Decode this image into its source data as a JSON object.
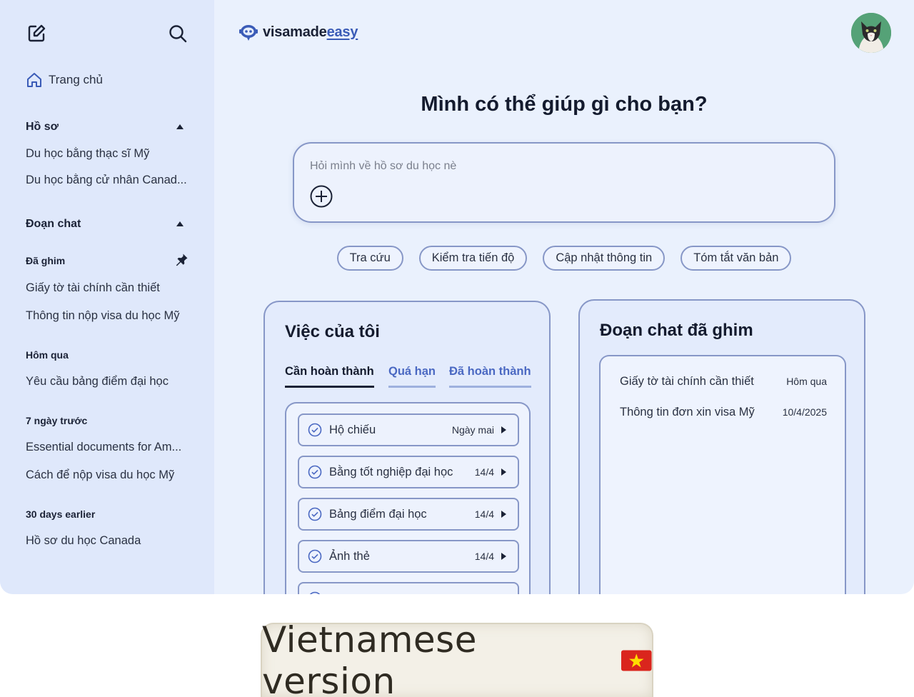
{
  "sidebar": {
    "new_chat_icon": "compose-icon",
    "search_icon": "search-icon",
    "home_label": "Trang chủ",
    "profiles": {
      "heading": "Hồ sơ",
      "items": [
        "Du học bằng thạc sĩ Mỹ",
        "Du học bằng cử nhân Canad..."
      ]
    },
    "chats": {
      "heading": "Đoạn chat",
      "groups": [
        {
          "title": "Đã ghim",
          "items": [
            "Giấy tờ tài chính cần thiết",
            "Thông tin nộp visa du học Mỹ"
          ]
        },
        {
          "title": "Hôm qua",
          "items": [
            "Yêu cầu bảng điểm đại học"
          ]
        },
        {
          "title": "7 ngày trước",
          "items": [
            "Essential documents for Am...",
            "Cách để nộp visa du học Mỹ"
          ]
        },
        {
          "title": "30 days earlier",
          "items": [
            "Hồ sơ du học Canada"
          ]
        }
      ]
    }
  },
  "header": {
    "logo_part1": "visamade",
    "logo_part2": "easy"
  },
  "main": {
    "headline": "Mình có thể giúp gì cho bạn?",
    "prompt_placeholder": "Hỏi mình về hồ sơ du học nè",
    "chips": [
      "Tra cứu",
      "Kiểm tra tiến độ",
      "Cập nhật thông tin",
      "Tóm tắt văn bản"
    ]
  },
  "tasks_card": {
    "title": "Việc của tôi",
    "tabs": [
      "Cần hoàn thành",
      "Quá hạn",
      "Đã hoàn thành"
    ],
    "active_tab": "Cần hoàn thành",
    "tasks": [
      {
        "label": "Hộ chiếu",
        "due": "Ngày mai"
      },
      {
        "label": "Bằng tốt nghiệp đại học",
        "due": "14/4"
      },
      {
        "label": "Bảng điểm đại học",
        "due": "14/4"
      },
      {
        "label": "Ảnh thẻ",
        "due": "14/4"
      }
    ]
  },
  "pinned_card": {
    "title": "Đoạn chat đã ghim",
    "rows": [
      {
        "title": "Giấy tờ tài chính cần thiết",
        "date": "Hôm qua"
      },
      {
        "title": "Thông tin đơn xin visa Mỹ",
        "date": "10/4/2025"
      }
    ]
  },
  "banner": {
    "text": "Vietnamese version",
    "flag": "🇻🇳"
  },
  "colors": {
    "sidebar_bg": "#dfe8fb",
    "main_bg": "#eaf1fd",
    "border": "#8797c7",
    "accent": "#4a68c2"
  }
}
